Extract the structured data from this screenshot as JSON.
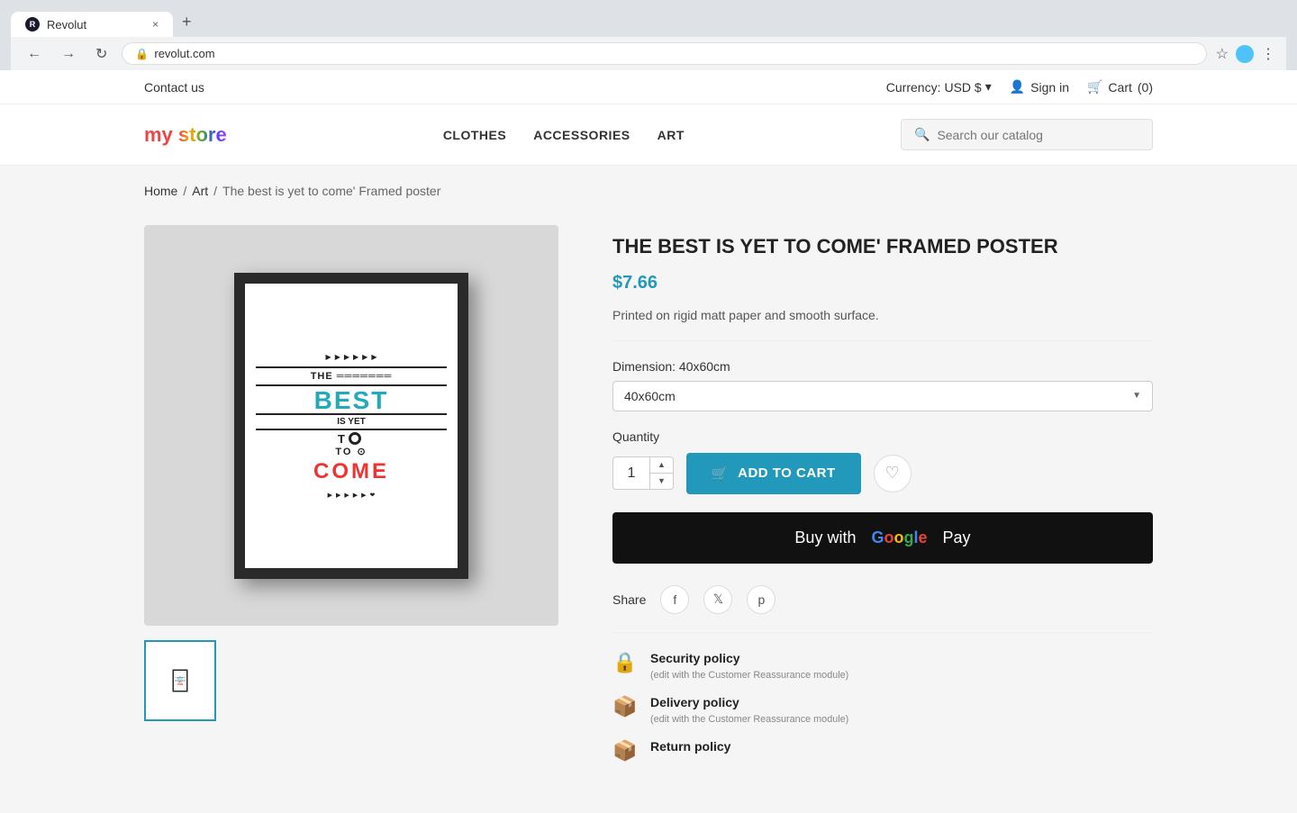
{
  "browser": {
    "tab_title": "Revolut",
    "tab_favicon": "R",
    "url": "revolut.com",
    "new_tab_label": "+",
    "close_tab_label": "×"
  },
  "top_bar": {
    "contact_us": "Contact us",
    "currency_label": "Currency:",
    "currency_value": "USD $",
    "sign_in": "Sign in",
    "cart": "Cart",
    "cart_count": "(0)"
  },
  "nav": {
    "logo_my": "my",
    "logo_store": "store",
    "links": [
      "CLOTHES",
      "ACCESSORIES",
      "ART"
    ],
    "search_placeholder": "Search our catalog"
  },
  "breadcrumb": {
    "home": "Home",
    "separator": "/",
    "art": "Art",
    "current": "The best is yet to come' Framed poster"
  },
  "product": {
    "title": "THE BEST IS YET TO COME' FRAMED POSTER",
    "price": "$7.66",
    "description": "Printed on rigid matt paper and smooth surface.",
    "dimension_label": "Dimension: 40x60cm",
    "dimension_value": "40x60cm",
    "quantity_label": "Quantity",
    "quantity_value": "1",
    "add_to_cart": "ADD TO CART",
    "buy_with": "Buy with",
    "pay": "Pay",
    "share_label": "Share",
    "policies": [
      {
        "name": "Security policy",
        "detail": "(edit with the Customer Reassurance module)"
      },
      {
        "name": "Delivery policy",
        "detail": "(edit with the Customer Reassurance module)"
      },
      {
        "name": "Return policy",
        "detail": ""
      }
    ]
  },
  "icons": {
    "search": "🔍",
    "user": "👤",
    "cart": "🛒",
    "cart_btn": "🛒",
    "heart": "♡",
    "facebook": "f",
    "twitter": "t",
    "pinterest": "p",
    "security": "🔒",
    "delivery": "📦",
    "return": "📦",
    "chevron_down": "▼",
    "chevron_up": "▲",
    "back": "←",
    "forward": "→",
    "refresh": "↻",
    "star": "☆",
    "menu": "⋮"
  }
}
